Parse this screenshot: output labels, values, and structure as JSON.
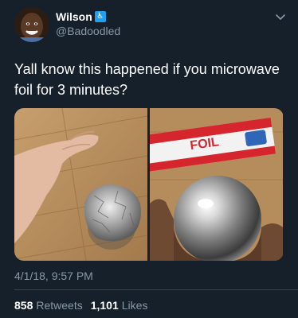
{
  "user": {
    "display_name": "Wilson",
    "badge_icon": "wheelchair-icon",
    "handle": "@Badoodled"
  },
  "tweet": {
    "text": "Yall know this happened if you microwave foil for 3 minutes?",
    "timestamp": "4/1/18, 9:57 PM"
  },
  "media": {
    "left_photo": "hand-and-crumpled-foil-ball",
    "right_photo": "hand-holding-polished-metal-sphere",
    "box_label": "FOIL"
  },
  "stats": {
    "retweets_count": "858",
    "retweets_label": "Retweets",
    "likes_count": "1,101",
    "likes_label": "Likes"
  },
  "colors": {
    "background": "#15202b",
    "muted": "#8899a6",
    "accent": "#1da1f2"
  }
}
